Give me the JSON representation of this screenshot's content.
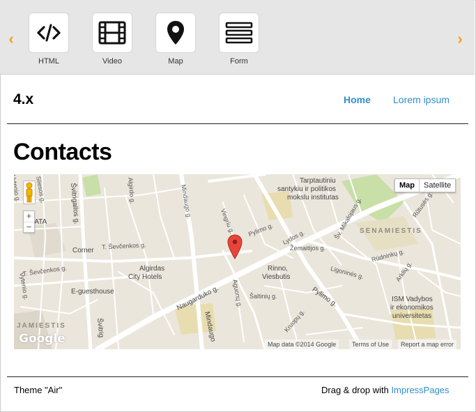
{
  "toolbar": {
    "prev_arrow": "‹",
    "next_arrow": "›",
    "widgets": [
      {
        "label": "HTML",
        "icon": "code-icon"
      },
      {
        "label": "Video",
        "icon": "film-icon"
      },
      {
        "label": "Map",
        "icon": "map-marker-icon"
      },
      {
        "label": "Form",
        "icon": "form-lines-icon"
      }
    ]
  },
  "header": {
    "site_title": "4.x",
    "nav": [
      {
        "label": "Home",
        "active": true
      },
      {
        "label": "Lorem ipsum",
        "active": false
      }
    ]
  },
  "main": {
    "heading": "Contacts"
  },
  "map": {
    "type_buttons": [
      "Map",
      "Satellite"
    ],
    "zoom_in": "+",
    "zoom_out": "−",
    "logo": "Google",
    "attribution": "Map data ©2014 Google",
    "terms": "Terms of Use",
    "report": "Report a map error",
    "labels": {
      "tarptautiniu": "Tarptautiniu",
      "santykiu": "santykiu ir politikos",
      "mokslu": "mokslu institutas",
      "senamiestis": "SENAMIESTIS",
      "corner": "Corner",
      "algirdas1": "Algirdas",
      "algirdas2": "City Hotels",
      "eguesthouse": "E-guesthouse",
      "rinno1": "Rinno,",
      "rinno2": "Viesbutis",
      "ism1": "ISM Vadybos",
      "ism2": "ir ekonomikos",
      "ism3": "universitetas",
      "jamiestis": "JAMIESTIS",
      "rata": "RATA",
      "sevcenkos1": "T. Ševčenkos g.",
      "sevcenkos2": "T. Ševčenkos g.",
      "naugarduko": "Naugarduko g.",
      "pylimo1": "Pylimo g.",
      "pylimo2": "Pylimo g.",
      "mindaugo1": "Mindaugo g.",
      "mindaugo2": "Mindaugo",
      "svitrigailos1": "Švitrigailos g.",
      "svitrigailos2": "Švitrig",
      "lydos": "Lydos g.",
      "zemaitijos": "Žemaitijos g.",
      "ligonines": "Ligoninės g.",
      "rudninku": "Rūdninkų g.",
      "saltiniu": "Šaltinių g.",
      "aguonu": "Aguonų g.",
      "vingriu": "Vingriu g.",
      "mikalojaus": "Šv. Mikalojaus g.",
      "vytenio1": "Vytenio g.",
      "vytenio2": "Vytenio g.",
      "algirdo": "Algirdo g.",
      "kruopu": "Kruopų g.",
      "arkliu": "Arklių g.",
      "rutuses": "Rūtusės g.",
      "sliesos": "Sliesos g."
    }
  },
  "footer": {
    "theme": "Theme \"Air\"",
    "drag_text": "Drag & drop with ",
    "brand_link": "ImpressPages"
  },
  "colors": {
    "accent": "#2f8fcb",
    "arrow": "#f2a31b",
    "toolbar_bg": "#e6e6e6",
    "map_bg": "#ebe6dc",
    "pin": "#e8443a"
  }
}
